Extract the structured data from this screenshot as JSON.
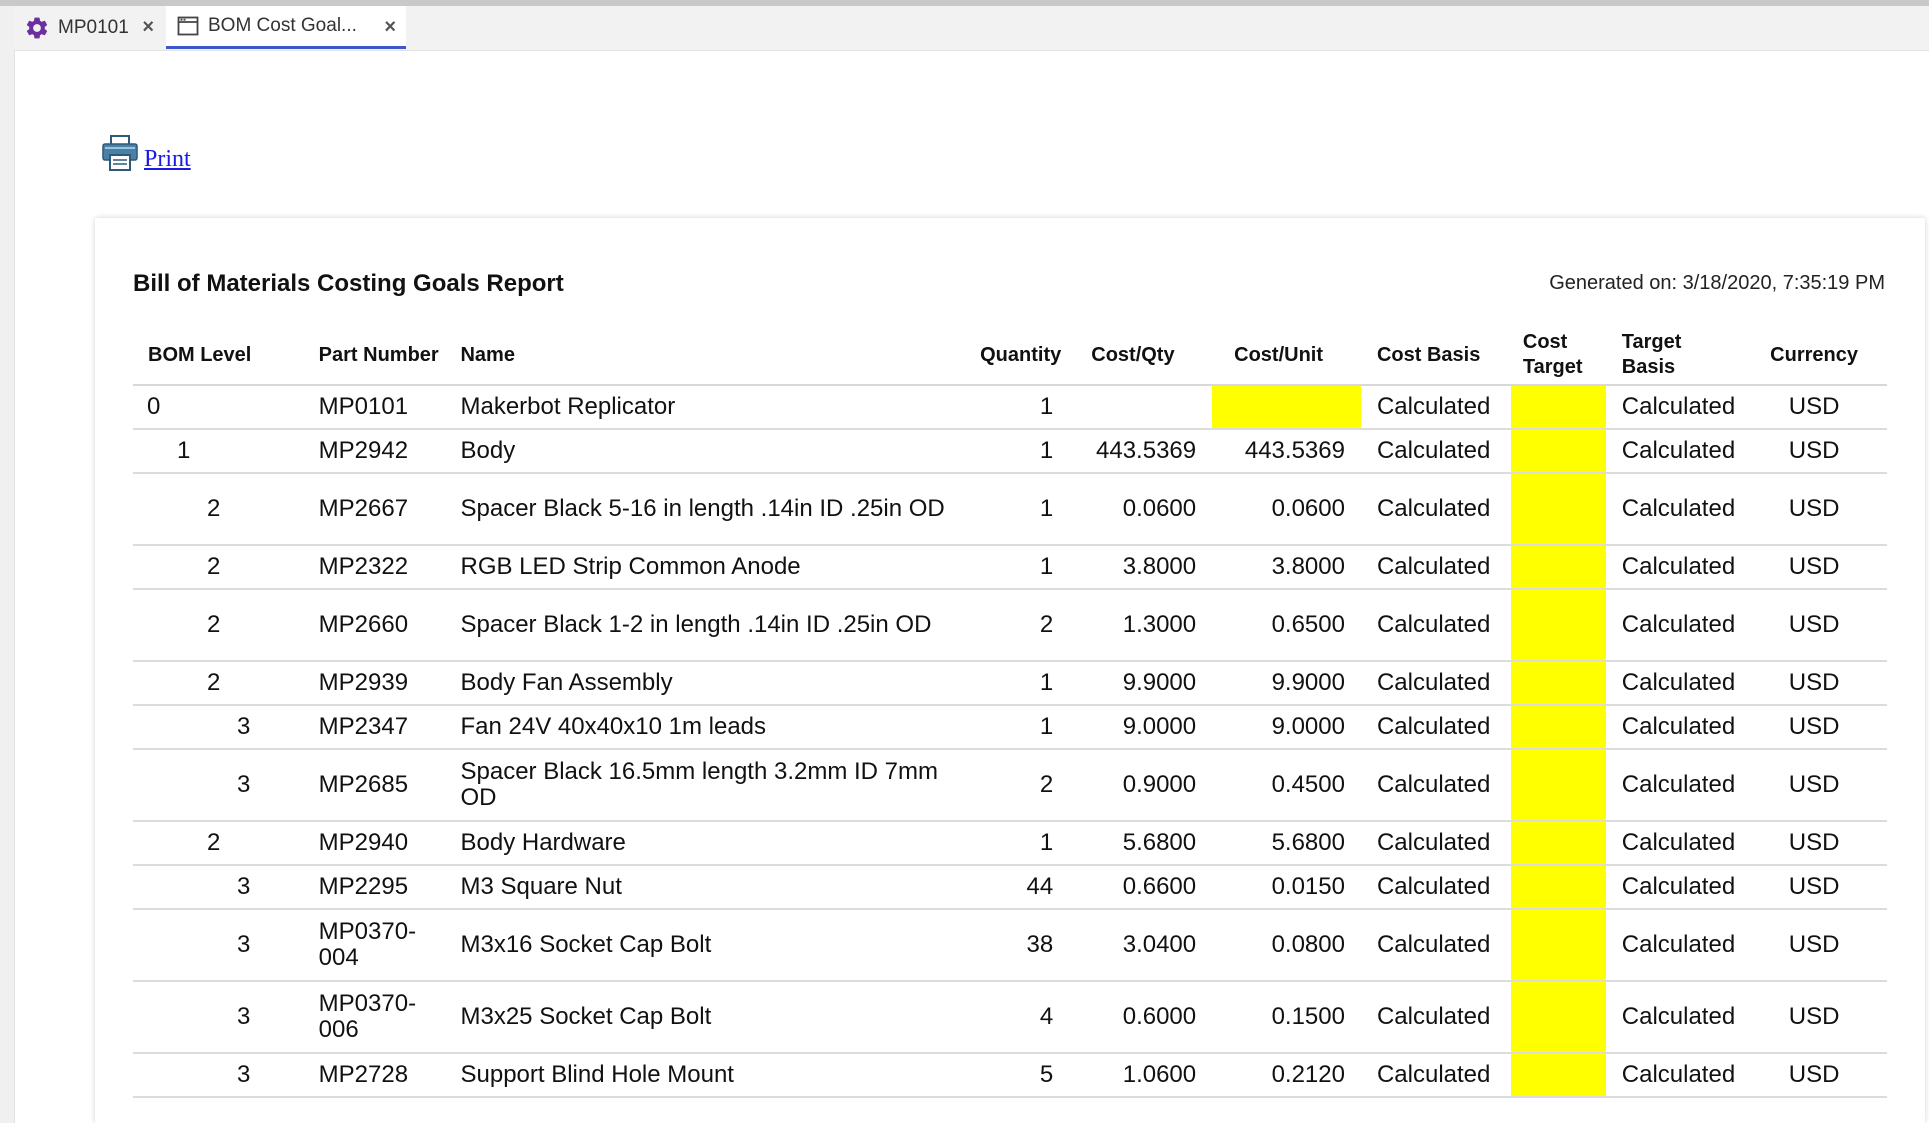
{
  "tabs": [
    {
      "label": "MP0101",
      "icon": "gear-icon",
      "icon_color": "#6b2fa0"
    },
    {
      "label": "BOM Cost Goal...",
      "icon": "window-icon",
      "active": true
    }
  ],
  "print": {
    "label": "Print",
    "icon": "printer-icon"
  },
  "report": {
    "title": "Bill of Materials Costing Goals Report",
    "generated": "Generated on: 3/18/2020, 7:35:19 PM",
    "highlight_color": "#ffff00",
    "columns": {
      "bom_level": "BOM Level",
      "part_number": "Part Number",
      "name": "Name",
      "quantity": "Quantity",
      "cost_qty": "Cost/Qty",
      "cost_unit": "Cost/Unit",
      "cost_basis": "Cost Basis",
      "cost_target": "Cost Target",
      "target_basis": "Target Basis",
      "currency": "Currency"
    },
    "rows": [
      {
        "level": "0",
        "depth": 0,
        "part": "MP0101",
        "name": "Makerbot Replicator",
        "qty": "1",
        "cost_qty": "",
        "cost_unit": "",
        "unit_highlight": true,
        "cost_basis": "Calculated",
        "cost_target": "",
        "target_basis": "Calculated",
        "currency": "USD"
      },
      {
        "level": "1",
        "depth": 1,
        "part": "MP2942",
        "name": "Body",
        "qty": "1",
        "cost_qty": "443.5369",
        "cost_unit": "443.5369",
        "cost_basis": "Calculated",
        "cost_target": "",
        "target_basis": "Calculated",
        "currency": "USD"
      },
      {
        "level": "2",
        "depth": 2,
        "part": "MP2667",
        "name": "Spacer Black 5-16 in length .14in ID .25in OD",
        "qty": "1",
        "cost_qty": "0.0600",
        "cost_unit": "0.0600",
        "cost_basis": "Calculated",
        "cost_target": "",
        "target_basis": "Calculated",
        "currency": "USD",
        "tall": true
      },
      {
        "level": "2",
        "depth": 2,
        "part": "MP2322",
        "name": "RGB LED Strip Common Anode",
        "qty": "1",
        "cost_qty": "3.8000",
        "cost_unit": "3.8000",
        "cost_basis": "Calculated",
        "cost_target": "",
        "target_basis": "Calculated",
        "currency": "USD"
      },
      {
        "level": "2",
        "depth": 2,
        "part": "MP2660",
        "name": "Spacer Black 1-2 in length .14in ID .25in OD",
        "qty": "2",
        "cost_qty": "1.3000",
        "cost_unit": "0.6500",
        "cost_basis": "Calculated",
        "cost_target": "",
        "target_basis": "Calculated",
        "currency": "USD",
        "tall": true
      },
      {
        "level": "2",
        "depth": 2,
        "part": "MP2939",
        "name": "Body Fan Assembly",
        "qty": "1",
        "cost_qty": "9.9000",
        "cost_unit": "9.9000",
        "cost_basis": "Calculated",
        "cost_target": "",
        "target_basis": "Calculated",
        "currency": "USD"
      },
      {
        "level": "3",
        "depth": 3,
        "part": "MP2347",
        "name": "Fan 24V 40x40x10 1m leads",
        "qty": "1",
        "cost_qty": "9.0000",
        "cost_unit": "9.0000",
        "cost_basis": "Calculated",
        "cost_target": "",
        "target_basis": "Calculated",
        "currency": "USD"
      },
      {
        "level": "3",
        "depth": 3,
        "part": "MP2685",
        "name": "Spacer Black 16.5mm length 3.2mm ID 7mm OD",
        "qty": "2",
        "cost_qty": "0.9000",
        "cost_unit": "0.4500",
        "cost_basis": "Calculated",
        "cost_target": "",
        "target_basis": "Calculated",
        "currency": "USD",
        "tall": true
      },
      {
        "level": "2",
        "depth": 2,
        "part": "MP2940",
        "name": "Body Hardware",
        "qty": "1",
        "cost_qty": "5.6800",
        "cost_unit": "5.6800",
        "cost_basis": "Calculated",
        "cost_target": "",
        "target_basis": "Calculated",
        "currency": "USD"
      },
      {
        "level": "3",
        "depth": 3,
        "part": "MP2295",
        "name": "M3 Square Nut",
        "qty": "44",
        "cost_qty": "0.6600",
        "cost_unit": "0.0150",
        "cost_basis": "Calculated",
        "cost_target": "",
        "target_basis": "Calculated",
        "currency": "USD"
      },
      {
        "level": "3",
        "depth": 3,
        "part": "MP0370-004",
        "name": "M3x16 Socket Cap Bolt",
        "qty": "38",
        "cost_qty": "3.0400",
        "cost_unit": "0.0800",
        "cost_basis": "Calculated",
        "cost_target": "",
        "target_basis": "Calculated",
        "currency": "USD",
        "tall": true
      },
      {
        "level": "3",
        "depth": 3,
        "part": "MP0370-006",
        "name": "M3x25 Socket Cap Bolt",
        "qty": "4",
        "cost_qty": "0.6000",
        "cost_unit": "0.1500",
        "cost_basis": "Calculated",
        "cost_target": "",
        "target_basis": "Calculated",
        "currency": "USD",
        "tall": true
      },
      {
        "level": "3",
        "depth": 3,
        "part": "MP2728",
        "name": "Support Blind Hole Mount",
        "qty": "5",
        "cost_qty": "1.0600",
        "cost_unit": "0.2120",
        "cost_basis": "Calculated",
        "cost_target": "",
        "target_basis": "Calculated",
        "currency": "USD"
      }
    ]
  }
}
